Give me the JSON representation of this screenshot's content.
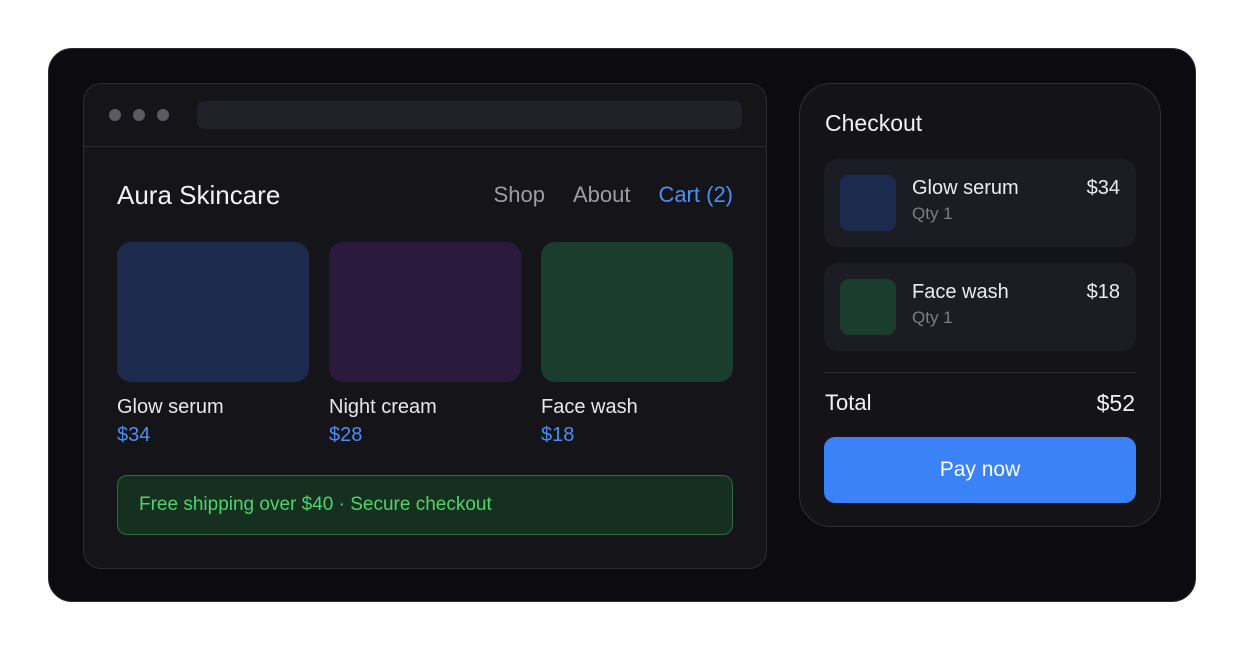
{
  "site": {
    "brand": "Aura Skincare",
    "nav": {
      "shop": "Shop",
      "about": "About",
      "cart": "Cart (2)"
    }
  },
  "products": [
    {
      "name": "Glow serum",
      "price": "$34",
      "color": "#1b2a4d"
    },
    {
      "name": "Night cream",
      "price": "$28",
      "color": "#2a1b3e"
    },
    {
      "name": "Face wash",
      "price": "$18",
      "color": "#1b3d30"
    }
  ],
  "banner": "Free shipping over $40 · Secure checkout",
  "checkout": {
    "title": "Checkout",
    "items": [
      {
        "name": "Glow serum",
        "qty": "Qty 1",
        "price": "$34",
        "color": "#1b2a4d"
      },
      {
        "name": "Face wash",
        "qty": "Qty 1",
        "price": "$18",
        "color": "#1b3d30"
      }
    ],
    "total_label": "Total",
    "total_value": "$52",
    "pay_label": "Pay now"
  },
  "colors": {
    "accent": "#3b82f6",
    "link": "#4b8ff5",
    "success": "#4ed36e"
  }
}
